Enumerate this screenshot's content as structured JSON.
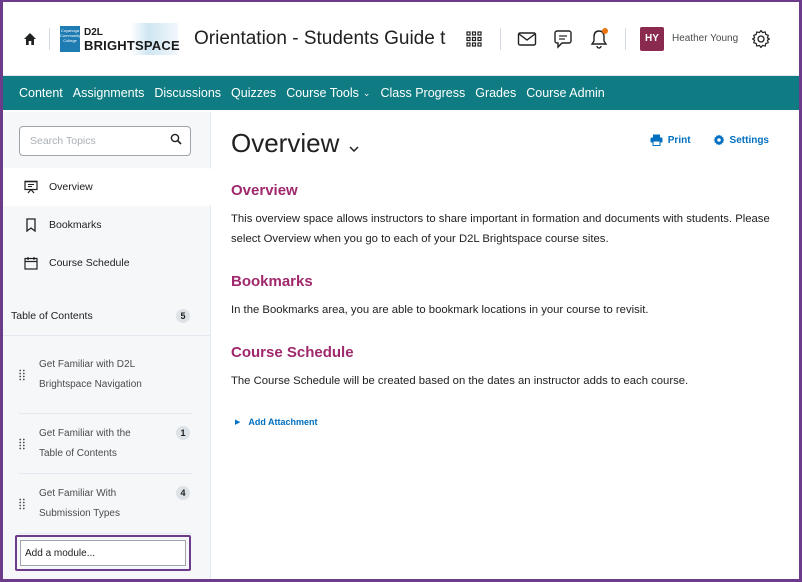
{
  "header": {
    "logo": {
      "line1": "D2L",
      "line2": "BRIGHTSPACE",
      "seal_text": "Cuyahoga Community College"
    },
    "course_title": "Orientation - Students Guide to ...",
    "user": {
      "initials": "HY",
      "name": "Heather Young"
    },
    "icons": [
      "home-icon",
      "apps-grid-icon",
      "mail-icon",
      "chat-icon",
      "bell-icon",
      "gear-icon"
    ],
    "notification_color": "#e87511"
  },
  "nav": {
    "items": [
      {
        "label": "Content"
      },
      {
        "label": "Assignments"
      },
      {
        "label": "Discussions"
      },
      {
        "label": "Quizzes"
      },
      {
        "label": "Course Tools",
        "dropdown": true
      },
      {
        "label": "Class Progress"
      },
      {
        "label": "Grades"
      },
      {
        "label": "Course Admin"
      }
    ],
    "color": "#0e7c82"
  },
  "sidebar": {
    "search_placeholder": "Search Topics",
    "links": [
      {
        "label": "Overview",
        "icon": "presentation-icon",
        "active": true
      },
      {
        "label": "Bookmarks",
        "icon": "bookmark-icon"
      },
      {
        "label": "Course Schedule",
        "icon": "calendar-icon"
      }
    ],
    "toc": {
      "label": "Table of Contents",
      "count": "5"
    },
    "modules": [
      {
        "label": "Get Familiar with D2L Brightspace Navigation",
        "count": ""
      },
      {
        "label": "Get Familiar with the Table of Contents",
        "count": "1"
      },
      {
        "label": "Get Familiar With Submission Types",
        "count": "4"
      }
    ],
    "add_module": "Add a module..."
  },
  "main": {
    "title": "Overview",
    "actions": {
      "print": "Print",
      "settings": "Settings"
    },
    "sections": [
      {
        "heading": "Overview",
        "text": "This overview space allows instructors to share important in formation and documents with students. Please select Overview when you go to each of your D2L Brightspace course sites."
      },
      {
        "heading": "Bookmarks",
        "text": "In the Bookmarks area, you are able to bookmark locations in your course to revisit."
      },
      {
        "heading": "Course Schedule",
        "text": "The Course Schedule will be created based on the dates an instructor adds to each course."
      }
    ],
    "add_attachment": "Add Attachment",
    "heading_color": "#a0286c",
    "link_color": "#006fbf"
  }
}
